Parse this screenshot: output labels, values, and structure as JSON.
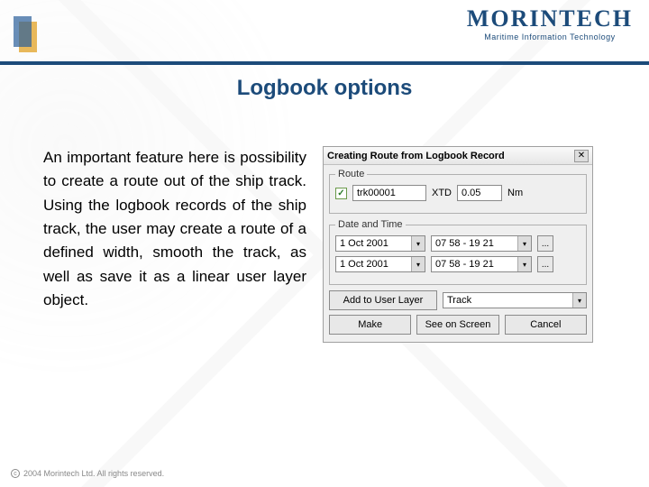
{
  "header": {
    "logo_brand": "MORINTECH",
    "logo_tagline": "Maritime Information Technology"
  },
  "heading": "Logbook options",
  "body_text": "An important feature here is possibility to create a route out of the ship track. Using the logbook records of the ship track, the user may create a route of a defined width, smooth the track, as well as save it as a linear user layer object.",
  "dialog": {
    "title": "Creating Route from Logbook Record",
    "route": {
      "legend": "Route",
      "checked": "✓",
      "name_value": "trk00001",
      "xtd_label": "XTD",
      "xtd_value": "0.05",
      "xtd_unit": "Nm"
    },
    "datetime": {
      "legend": "Date and Time",
      "date1": "1 Oct 2001",
      "time1": "07 58 - 19 21",
      "date2": "1 Oct 2001",
      "time2": "07 58 - 19 21",
      "ellipsis": "..."
    },
    "layer": {
      "add_label": "Add to User Layer",
      "track_value": "Track"
    },
    "buttons": {
      "make": "Make",
      "see": "See on Screen",
      "cancel": "Cancel"
    }
  },
  "footer": "2004 Morintech Ltd. All rights reserved."
}
